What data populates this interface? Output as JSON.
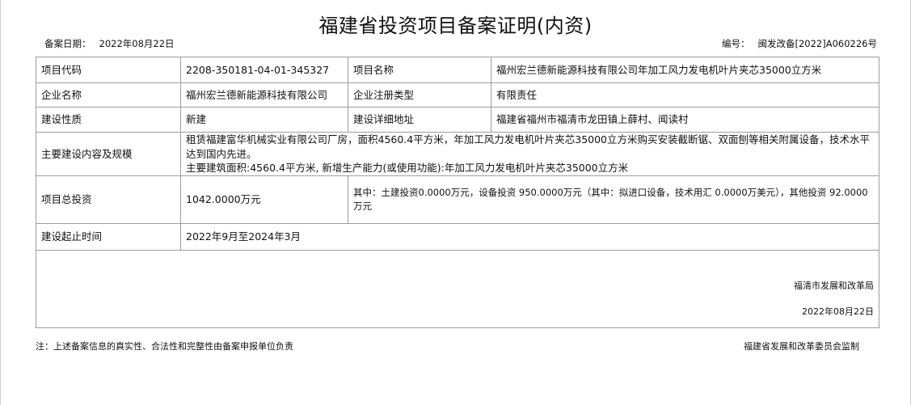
{
  "doc": {
    "title": "福建省投资项目备案证明(内资)",
    "record_date_label": "备案日期：",
    "record_date": "2022年08月22日",
    "number_label": "编号：",
    "number": "闽发改备[2022]A060226号"
  },
  "rows": {
    "project_code_label": "项目代码",
    "project_code": "2208-350181-04-01-345327",
    "project_name_label": "项目名称",
    "project_name": "福州宏兰德新能源科技有限公司年加工风力发电机叶片夹芯35000立方米",
    "company_label": "企业名称",
    "company": "福州宏兰德新能源科技有限公司",
    "company_type_label": "企业注册类型",
    "company_type": "有限责任",
    "nature_label": "建设性质",
    "nature": "新建",
    "address_label": "建设详细地址",
    "address": "福建省福州市福清市龙田镇上薛村、闻读村",
    "content_label": "主要建设内容及规模",
    "content_line1": "租赁福建富华机械实业有限公司厂房，面积4560.4平方米，年加工风力发电机叶片夹芯35000立方米购买安装截断锯、双面刨等相关附属设备，技术水平达到国内先进。",
    "content_line2": "主要建筑面积:4560.4平方米, 新增生产能力(或使用功能):年加工风力发电机叶片夹芯35000立方米",
    "investment_label": "项目总投资",
    "investment_total": "1042.0000万元",
    "investment_detail": "其中：土建投资0.0000万元，设备投资 950.0000万元（其中：拟进口设备，技术用汇 0.0000万美元），其他投资 92.0000万元",
    "period_label": "建设起止时间",
    "period": "2022年9月至2024年3月"
  },
  "footer": {
    "issuer": "福清市发展和改革局",
    "issue_date": "2022年08月22日",
    "note": "注：上述备案信息的真实性、合法性和完整性由备案申报单位负责",
    "supervisor": "福建省发展和改革委员会监制"
  }
}
